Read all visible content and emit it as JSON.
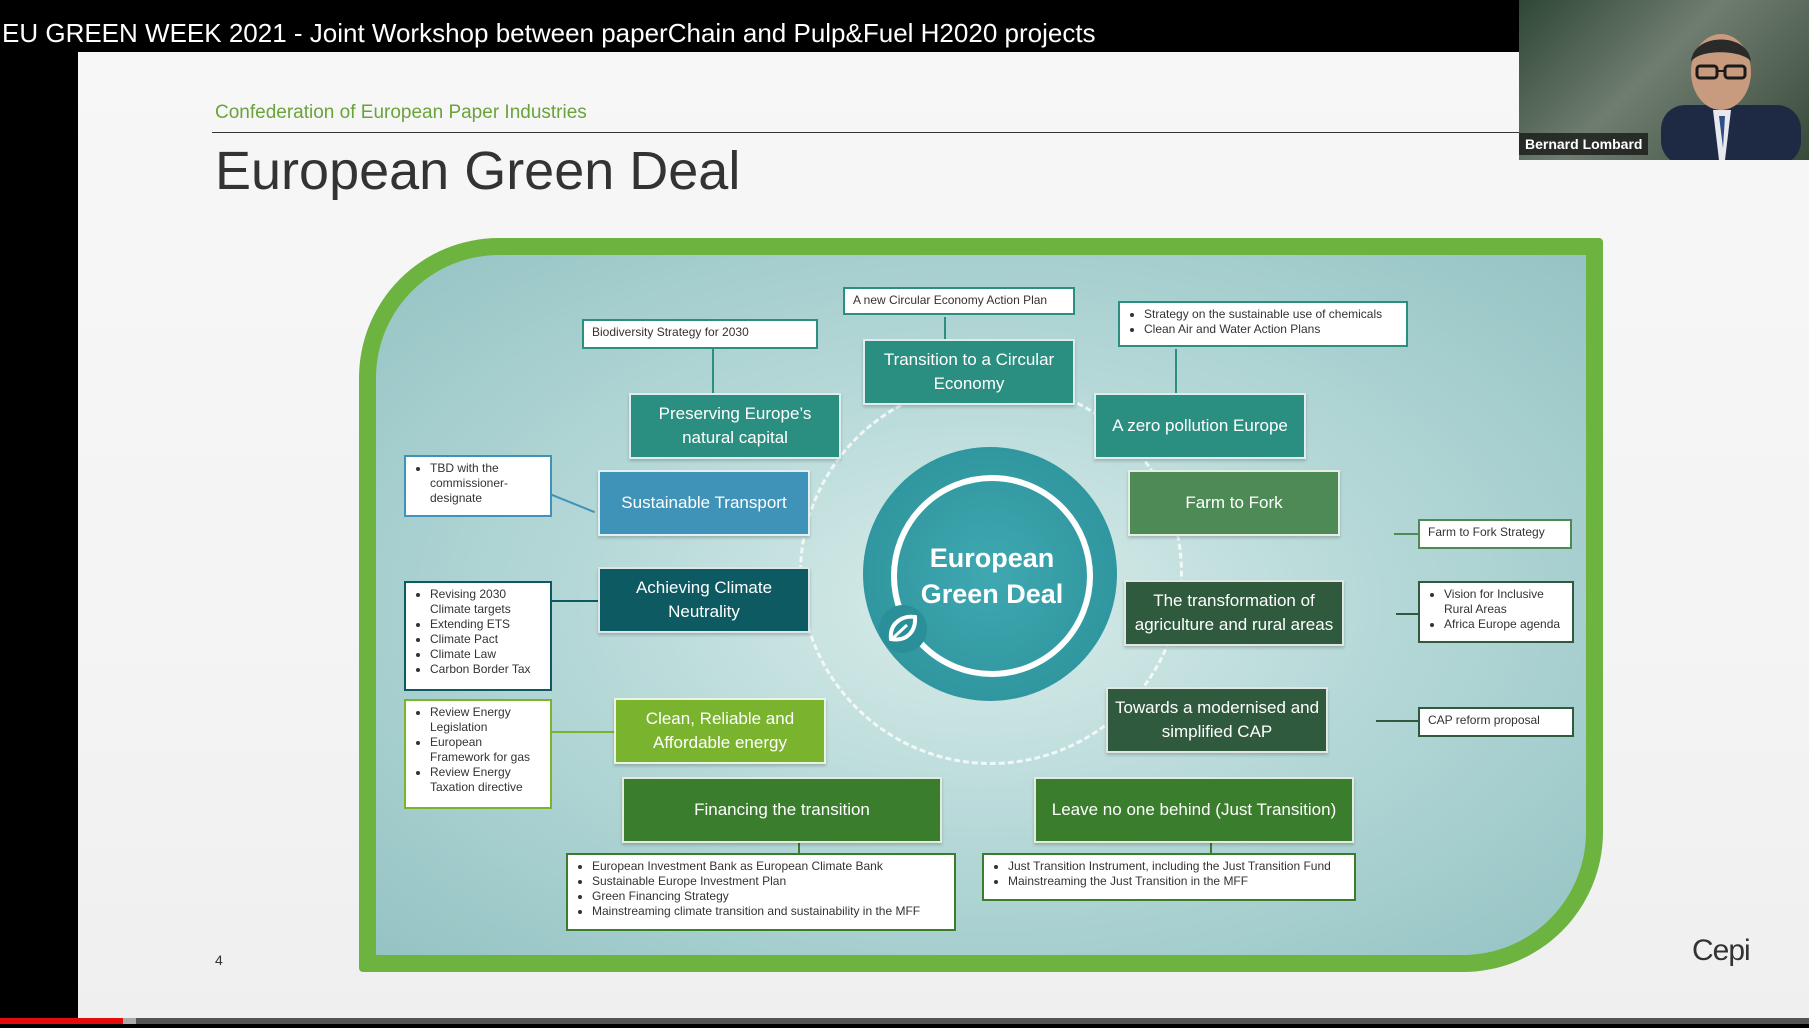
{
  "video": {
    "title": "EU GREEN WEEK 2021 - Joint Workshop between paperChain and Pulp&Fuel H2020 projects",
    "progress": 0.068,
    "buffered": 0.075
  },
  "webcam": {
    "name": "Bernard Lombard"
  },
  "slide": {
    "org": "Confederation of European Paper Industries",
    "title": "European Green Deal",
    "page": "4",
    "logo": "Cepi",
    "center": "European Green Deal",
    "nodes": {
      "circular": "Transition to a Circular Economy",
      "natural": "Preserving Europe’s natural capital",
      "zero": "A zero pollution Europe",
      "transport": "Sustainable Transport",
      "farm": "Farm to Fork",
      "climate": "Achieving Climate Neutrality",
      "agri": "The transformation of agriculture and rural areas",
      "energy": "Clean, Reliable and Affordable energy",
      "cap": "Towards a modernised and simplified CAP",
      "financing": "Financing the transition",
      "leave": "Leave no one behind (Just Transition)"
    },
    "boxes": {
      "circular": "A new Circular Economy Action Plan",
      "biodiversity": "Biodiversity Strategy for 2030",
      "chemicals": [
        "Strategy on the sustainable use of chemicals",
        "Clean Air and Water Action Plans"
      ],
      "transport": [
        "TBD with the commissioner-designate"
      ],
      "farm": "Farm to Fork Strategy",
      "climate": [
        "Revising 2030 Climate targets",
        "Extending ETS",
        "Climate Pact",
        "Climate Law",
        "Carbon Border Tax"
      ],
      "rural": [
        "Vision for Inclusive Rural Areas",
        "Africa Europe agenda"
      ],
      "energy": [
        "Review Energy Legislation",
        "European Framework for gas",
        "Review Energy Taxation directive"
      ],
      "cap": "CAP reform proposal",
      "financing": [
        "European Investment Bank as European Climate Bank",
        "Sustainable Europe Investment Plan",
        "Green Financing Strategy",
        "Mainstreaming climate transition and sustainability in the MFF"
      ],
      "just": [
        "Just Transition Instrument, including the Just Transition Fund",
        "Mainstreaming the Just Transition in the MFF"
      ]
    },
    "colors": {
      "frame": "#6db33f",
      "teal": "#2a8f80",
      "blue": "#3f93b8",
      "darkTeal": "#0e5a63",
      "olive": "#7ab32e",
      "green": "#3a7d2c",
      "darkGreen": "#2f5a3e",
      "lightGreen": "#4d8a55"
    }
  }
}
